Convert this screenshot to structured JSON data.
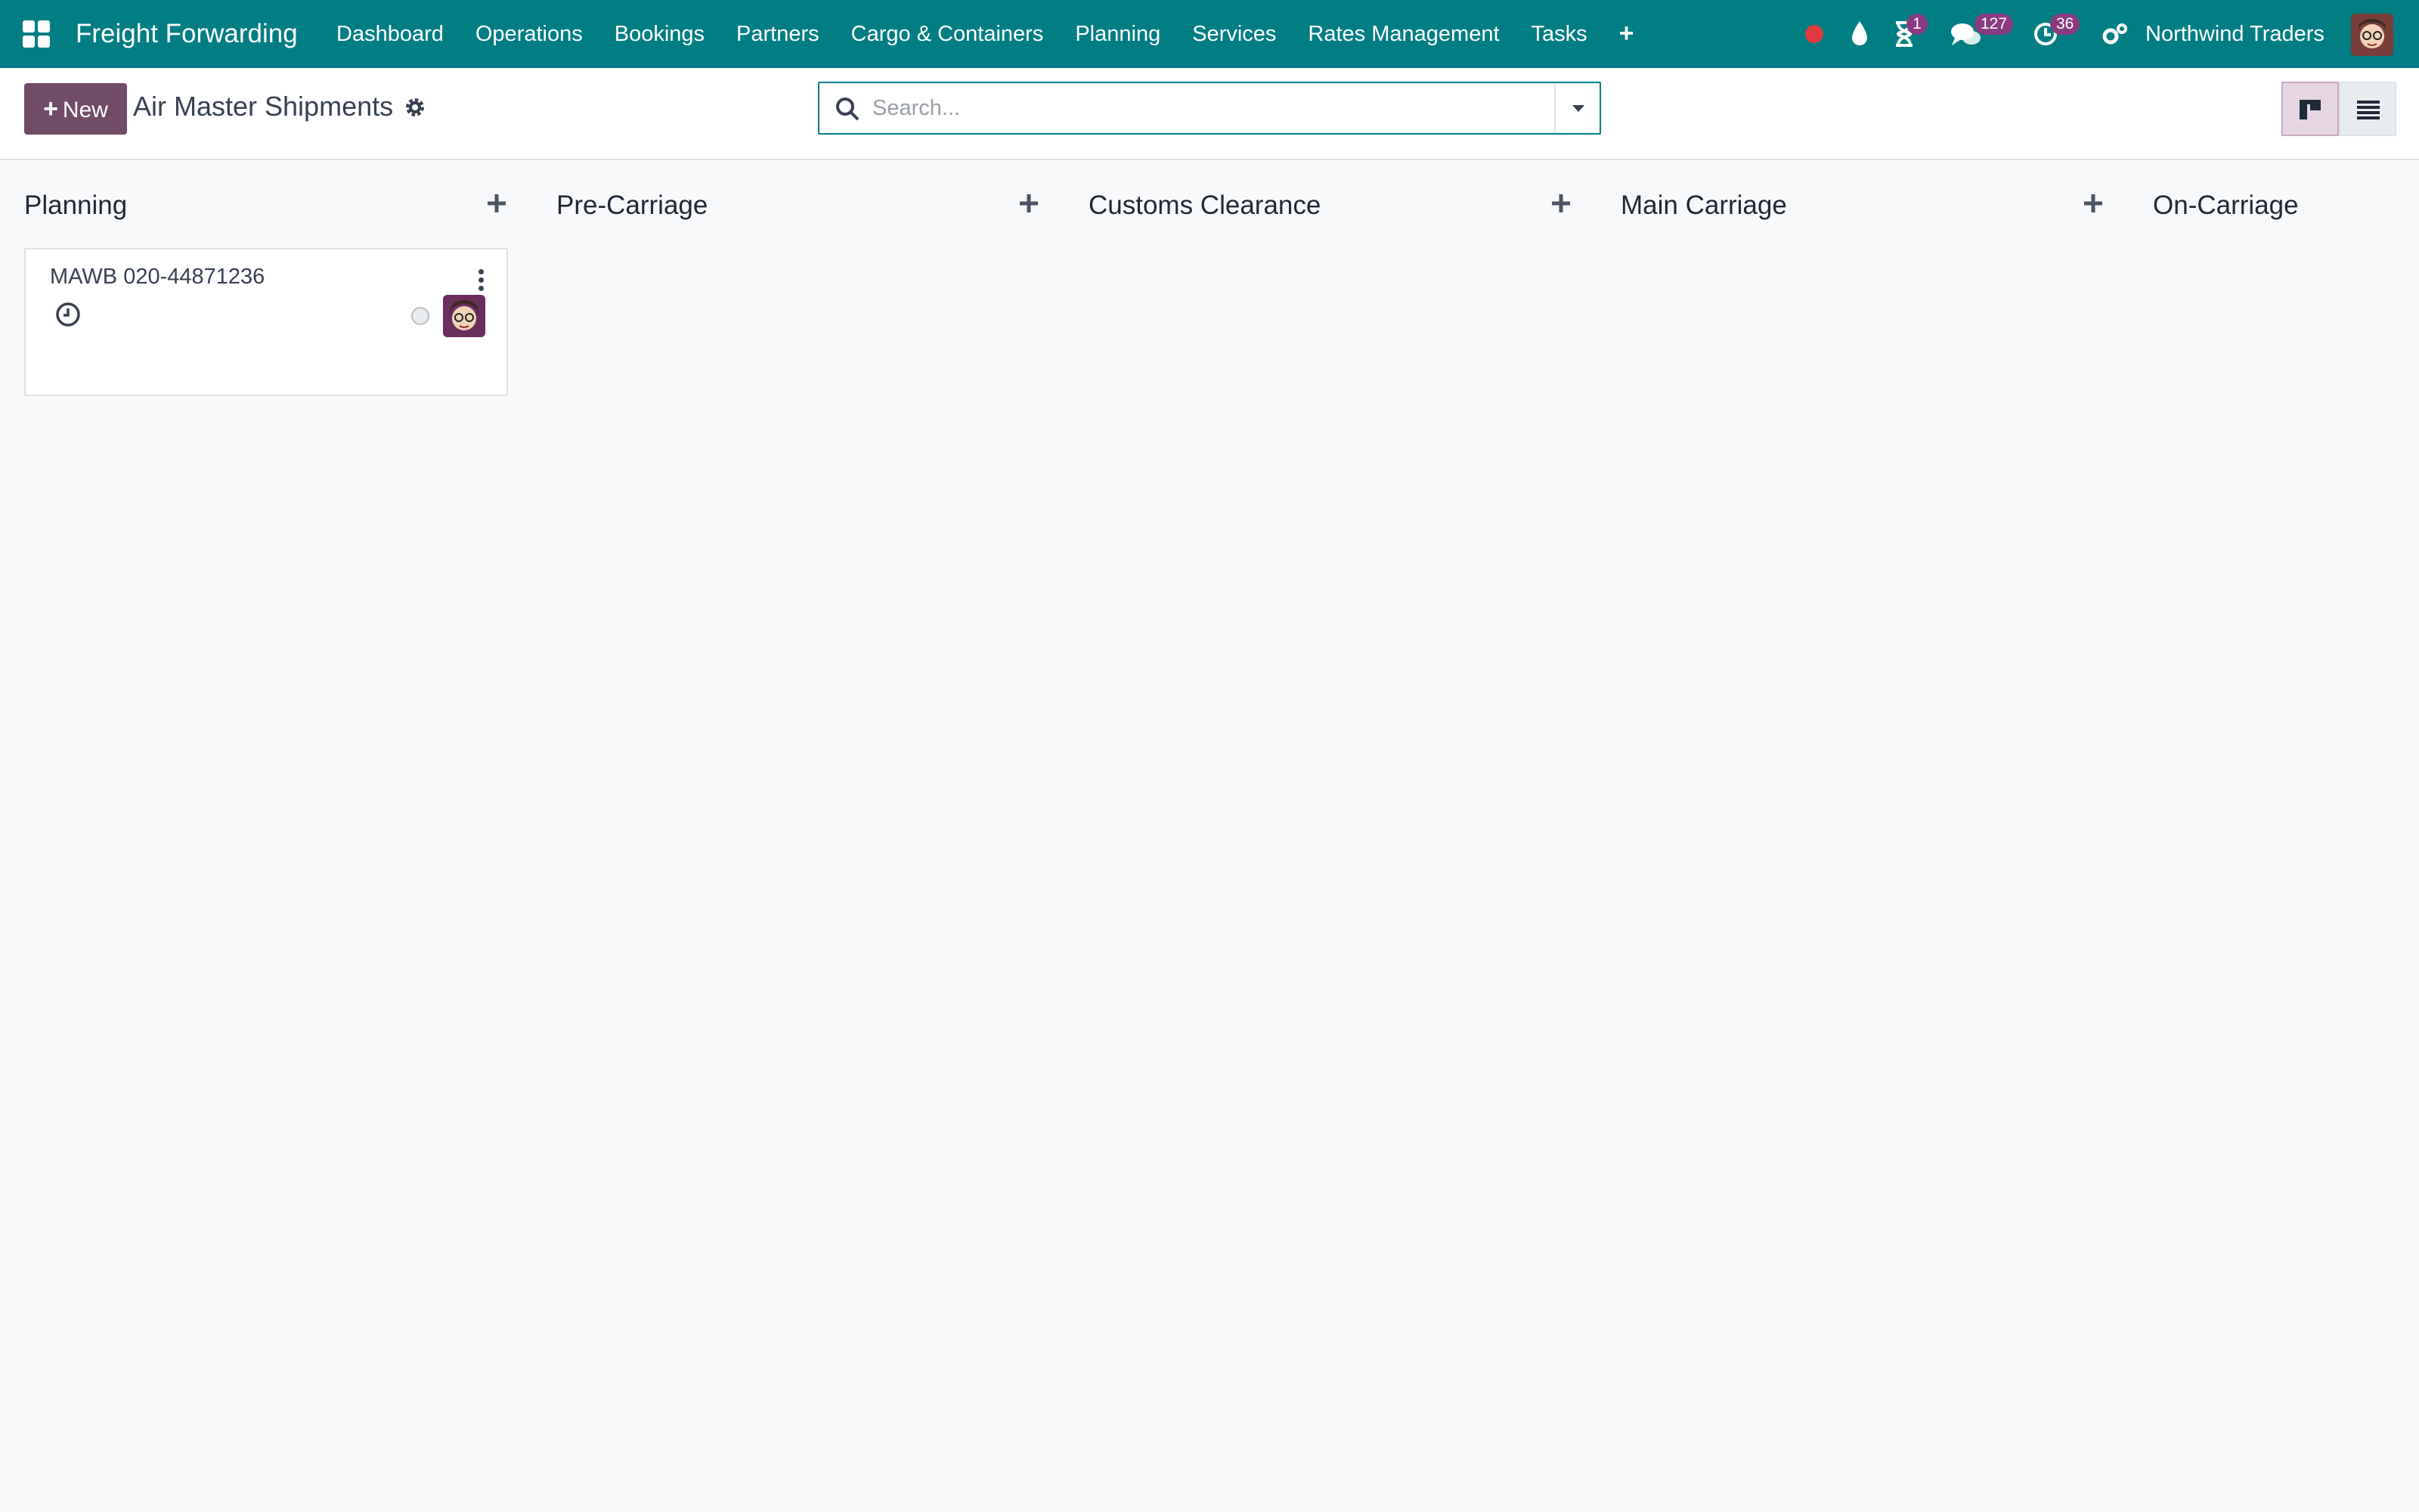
{
  "navbar": {
    "brand": "Freight Forwarding",
    "menu": [
      "Dashboard",
      "Operations",
      "Bookings",
      "Partners",
      "Cargo & Containers",
      "Planning",
      "Services",
      "Rates Management",
      "Tasks"
    ],
    "menu_plus": "+",
    "systray": {
      "activity_badge": "1",
      "messages_badge": "127",
      "clock_badge": "36",
      "company": "Northwind Traders"
    }
  },
  "control_panel": {
    "new_label": "New",
    "title": "Air Master Shipments",
    "search_placeholder": "Search..."
  },
  "kanban": {
    "columns": [
      {
        "title": "Planning",
        "add": "+"
      },
      {
        "title": "Pre-Carriage",
        "add": "+"
      },
      {
        "title": "Customs Clearance",
        "add": "+"
      },
      {
        "title": "Main Carriage",
        "add": "+"
      },
      {
        "title": "On-Carriage"
      }
    ],
    "cards": [
      {
        "title": "MAWB 020-44871236"
      }
    ]
  },
  "colors": {
    "navbar_bg": "#017e84",
    "primary_button": "#714b67",
    "badge": "#8a3a80",
    "record_dot": "#e0393e"
  },
  "icons": [
    "apps-grid-icon",
    "record-dot-icon",
    "water-drop-icon",
    "hourglass-icon",
    "chat-bubbles-icon",
    "clock-icon",
    "settings-icon",
    "search-icon",
    "caret-down-icon",
    "kanban-view-icon",
    "list-view-icon",
    "plus-icon",
    "kebab-icon",
    "status-circle-icon"
  ]
}
